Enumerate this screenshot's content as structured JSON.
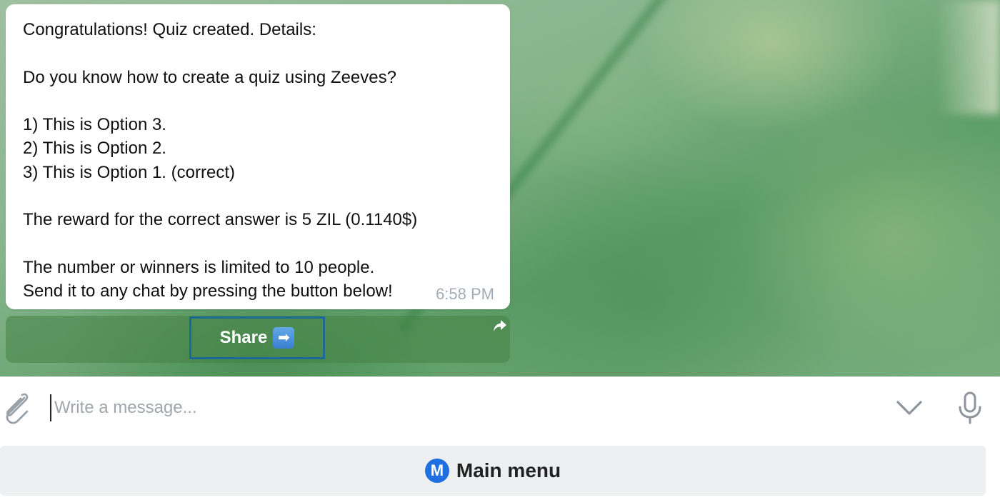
{
  "message": {
    "lines": [
      "Congratulations! Quiz created. Details:",
      "",
      "Do you know how to create a quiz using Zeeves?",
      "",
      "1) This is Option 3.",
      "2) This is Option 2.",
      "3) This is Option 1. (correct)",
      "",
      "The reward for the correct answer is 5 ZIL (0.1140$)",
      "",
      "The number or winners is limited to 10 people.",
      "Send it to any chat by pressing the button below!"
    ],
    "time": "6:58 PM"
  },
  "inline_keyboard": {
    "share_label": "Share",
    "share_emoji": "➡",
    "forward_icon": "forward-arrow-icon"
  },
  "composer": {
    "placeholder": "Write a message...",
    "value": "",
    "icons": [
      "paperclip-icon",
      "chevron-down-icon",
      "microphone-icon"
    ]
  },
  "reply_keyboard": {
    "badge_letter": "M",
    "main_menu_label": "Main menu"
  },
  "colors": {
    "accent_blue": "#1f6fe0",
    "share_outline": "#1b6a96",
    "bubble_bg": "#ffffff",
    "time_gray": "#a3acb6"
  }
}
